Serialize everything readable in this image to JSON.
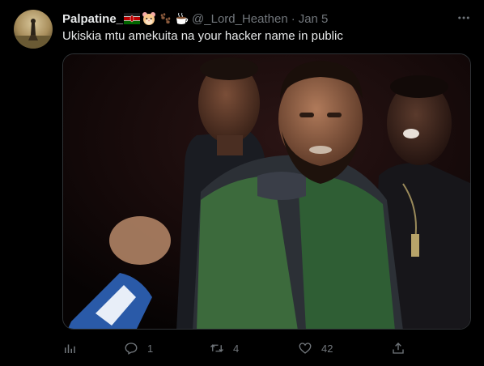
{
  "author": {
    "display_name": "Palpatine_",
    "emoji_names": [
      "kenya-flag",
      "hamster-face",
      "paw-prints",
      "hot-beverage"
    ],
    "handle": "@_Lord_Heathen",
    "date": "Jan 5"
  },
  "tweet": {
    "text": "Ukiskia mtu amekuita na your hacker name in public"
  },
  "actions": {
    "views_icon": "bar-chart-icon",
    "reply_count": "1",
    "retweet_count": "4",
    "like_count": "42",
    "share_icon": "share-icon"
  },
  "colors": {
    "background": "#000000",
    "text_primary": "#e7e9ea",
    "text_secondary": "#71767b",
    "border": "#2f3336"
  }
}
